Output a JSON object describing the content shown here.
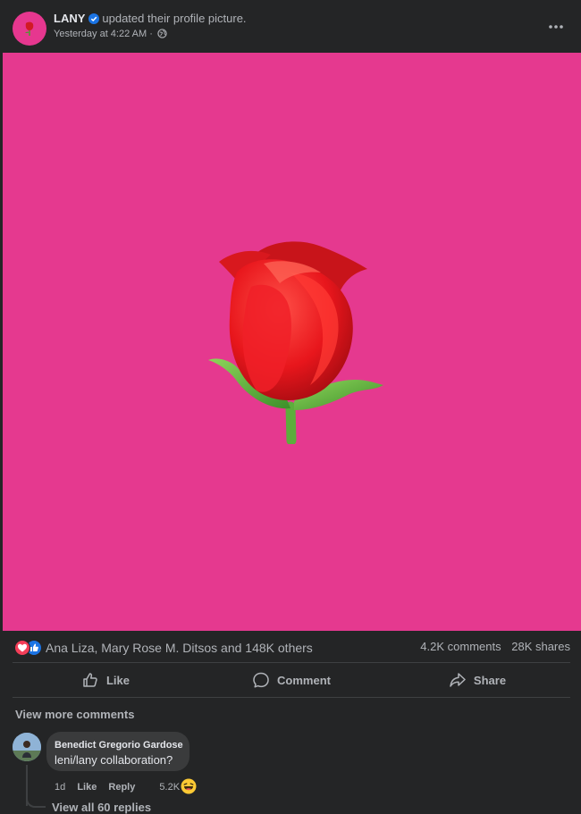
{
  "post": {
    "author": "LANY",
    "action": "updated their profile picture.",
    "timestamp": "Yesterday at 4:22 AM",
    "separator": "·",
    "privacy_icon": "globe-icon",
    "more_icon": "more-horizontal-icon"
  },
  "photo": {
    "background_color": "#e5398f",
    "subject_icon": "rose-icon"
  },
  "stats": {
    "reaction_icons": [
      "love-reaction-icon",
      "like-reaction-icon"
    ],
    "reactors": "Ana Liza, Mary Rose M. Ditsos and 148K others",
    "comments": "4.2K comments",
    "shares": "28K shares"
  },
  "actions": {
    "like_label": "Like",
    "comment_label": "Comment",
    "share_label": "Share"
  },
  "comments": {
    "view_more": "View more comments",
    "items": [
      {
        "author": "Benedict Gregorio Gardose",
        "text": "leni/lany collaboration?",
        "age": "1d",
        "like_label": "Like",
        "reply_label": "Reply",
        "reaction_count": "5.2K",
        "reaction_icon": "haha-reaction-icon"
      }
    ],
    "replies_partial": "View all 60 replies"
  },
  "colors": {
    "background": "#242526",
    "bubble": "#3a3b3c",
    "primary_text": "#e4e6eb",
    "secondary_text": "#b0b3b8",
    "verified_blue": "#1b74e4",
    "love_red": "#f33e58"
  }
}
